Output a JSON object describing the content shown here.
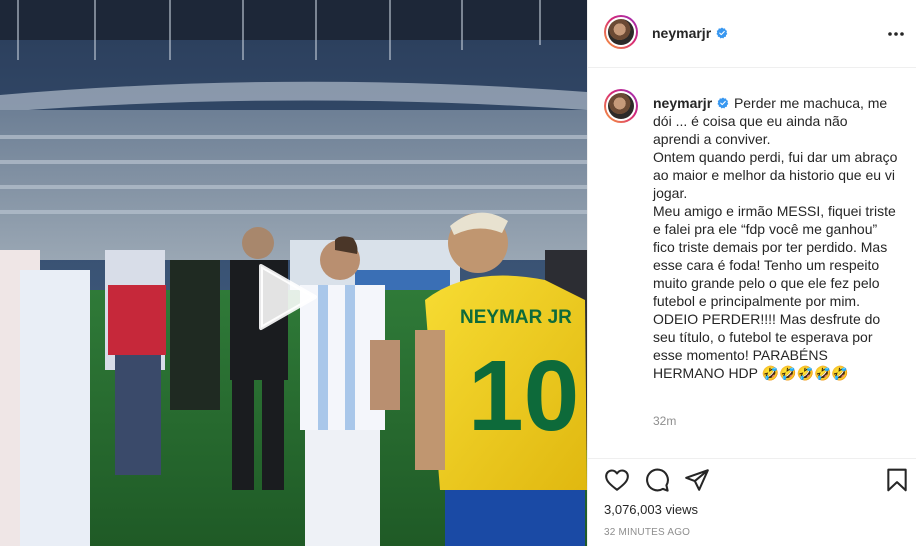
{
  "post": {
    "username": "neymarjr",
    "verified": true
  },
  "video": {
    "play_label": "Play"
  },
  "caption": {
    "username": "neymarjr",
    "lines": [
      "Perder me machuca, me dói ... é coisa que eu ainda não aprendi a conviver.",
      "Ontem quando perdi, fui dar um abraço ao maior e melhor da historio que eu vi jogar.",
      "Meu amigo e irmão MESSI, fiquei triste e falei pra ele “fdp você me ganhou” fico triste demais por ter perdido. Mas esse cara é foda! Tenho um respeito muito grande pelo o que ele fez pelo futebol e principalmente por mim.",
      "ODEIO PERDER!!!! Mas desfrute do seu título, o futebol te esperava por esse momento! PARABÉNS HERMANO HDP 🤣🤣🤣🤣🤣"
    ],
    "time": "32m"
  },
  "stats": {
    "views": "3,076,003 views",
    "ago": "32 minutes ago"
  },
  "icons": {
    "like": "heart-icon",
    "comment": "comment-icon",
    "share": "send-icon",
    "save": "bookmark-icon",
    "more": "more-options-icon"
  },
  "colors": {
    "verified": "#3897f0",
    "text": "#262626",
    "muted": "#8e8e8e",
    "jersey": "#f6d21c"
  }
}
